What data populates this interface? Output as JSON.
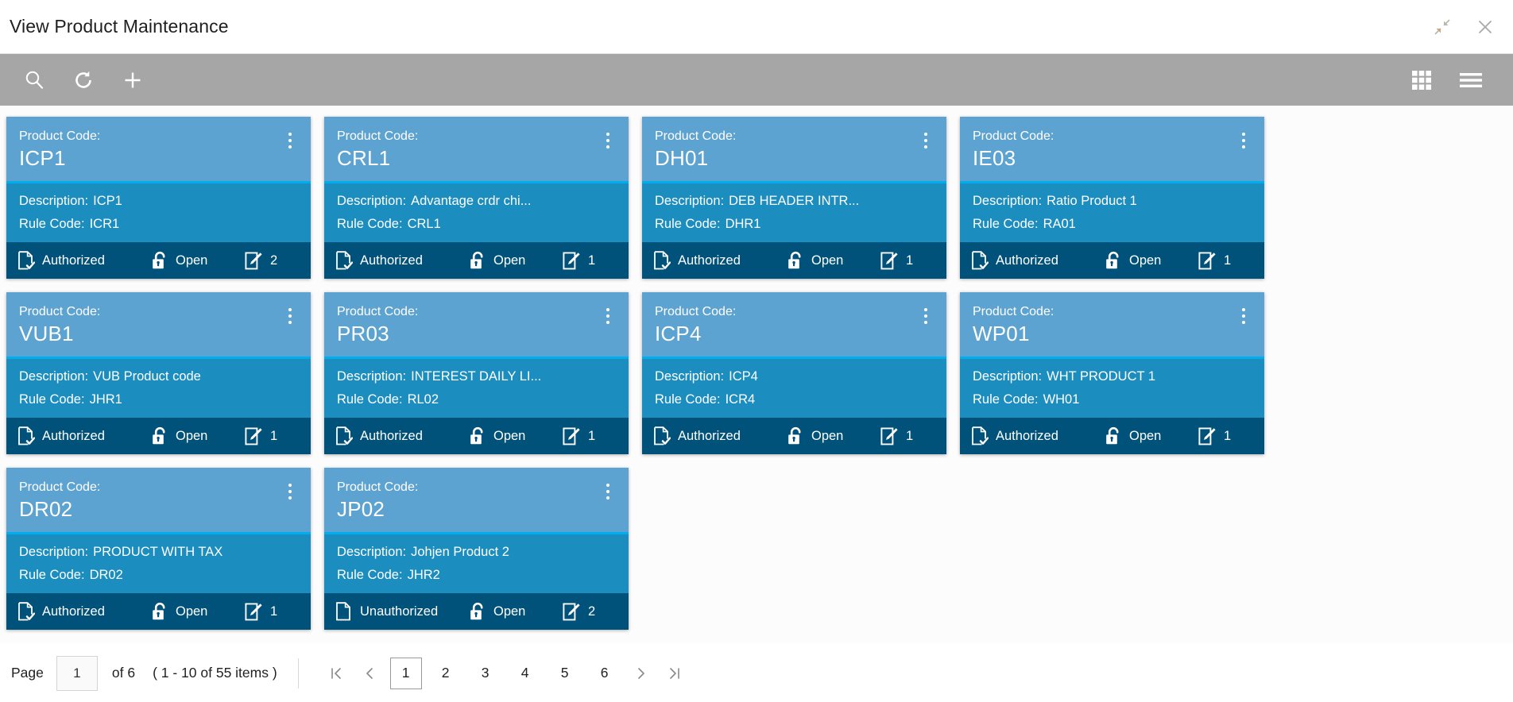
{
  "window": {
    "title": "View Product Maintenance",
    "collapse_icon": "collapse-arrows-icon",
    "close_icon": "close-icon"
  },
  "toolbar": {
    "left_buttons": [
      {
        "name": "search-button",
        "icon": "search-icon"
      },
      {
        "name": "refresh-button",
        "icon": "refresh-icon"
      },
      {
        "name": "add-button",
        "icon": "plus-icon"
      }
    ],
    "right_buttons": [
      {
        "name": "grid-view-button",
        "icon": "grid-icon"
      },
      {
        "name": "list-view-button",
        "icon": "hamburger-icon"
      }
    ]
  },
  "card_labels": {
    "product_code": "Product Code:",
    "description": "Description:",
    "rule_code": "Rule Code:",
    "menu_icon": "kebab-menu-icon",
    "authorized_icon": "document-check-icon",
    "unauthorized_icon": "document-icon",
    "lock_icon": "unlock-icon",
    "modification_icon": "edit-pencil-icon"
  },
  "colors": {
    "card_header": "#5DA3D2",
    "card_divider": "#00AEEF",
    "card_body": "#1B8DBF",
    "card_footer": "#00527A",
    "toolbar": "#A6A6A6"
  },
  "cards": [
    {
      "product_code": "ICP1",
      "description": "ICP1",
      "rule_code": "ICR1",
      "auth_status": "Authorized",
      "auth_state": "authorized",
      "lock_status": "Open",
      "mod_count": "2"
    },
    {
      "product_code": "CRL1",
      "description": "Advantage crdr chi...",
      "rule_code": "CRL1",
      "auth_status": "Authorized",
      "auth_state": "authorized",
      "lock_status": "Open",
      "mod_count": "1"
    },
    {
      "product_code": "DH01",
      "description": "DEB HEADER INTR...",
      "rule_code": "DHR1",
      "auth_status": "Authorized",
      "auth_state": "authorized",
      "lock_status": "Open",
      "mod_count": "1"
    },
    {
      "product_code": "IE03",
      "description": "Ratio Product 1",
      "rule_code": "RA01",
      "auth_status": "Authorized",
      "auth_state": "authorized",
      "lock_status": "Open",
      "mod_count": "1"
    },
    {
      "product_code": "VUB1",
      "description": "VUB Product code",
      "rule_code": "JHR1",
      "auth_status": "Authorized",
      "auth_state": "authorized",
      "lock_status": "Open",
      "mod_count": "1"
    },
    {
      "product_code": "PR03",
      "description": "INTEREST DAILY LI...",
      "rule_code": "RL02",
      "auth_status": "Authorized",
      "auth_state": "authorized",
      "lock_status": "Open",
      "mod_count": "1"
    },
    {
      "product_code": "ICP4",
      "description": "ICP4",
      "rule_code": "ICR4",
      "auth_status": "Authorized",
      "auth_state": "authorized",
      "lock_status": "Open",
      "mod_count": "1"
    },
    {
      "product_code": "WP01",
      "description": "WHT PRODUCT 1",
      "rule_code": "WH01",
      "auth_status": "Authorized",
      "auth_state": "authorized",
      "lock_status": "Open",
      "mod_count": "1"
    },
    {
      "product_code": "DR02",
      "description": "PRODUCT WITH TAX",
      "rule_code": "DR02",
      "auth_status": "Authorized",
      "auth_state": "authorized",
      "lock_status": "Open",
      "mod_count": "1"
    },
    {
      "product_code": "JP02",
      "description": "Johjen Product 2",
      "rule_code": "JHR2",
      "auth_status": "Unauthorized",
      "auth_state": "unauthorized",
      "lock_status": "Open",
      "mod_count": "2"
    }
  ],
  "pagination": {
    "page_label": "Page",
    "page_value": "1",
    "of_text": "of 6",
    "items_text": "( 1 - 10 of 55 items )",
    "first_icon": "first-page-icon",
    "prev_icon": "prev-page-icon",
    "next_icon": "next-page-icon",
    "last_icon": "last-page-icon",
    "pages": [
      "1",
      "2",
      "3",
      "4",
      "5",
      "6"
    ],
    "active_page": "1"
  }
}
